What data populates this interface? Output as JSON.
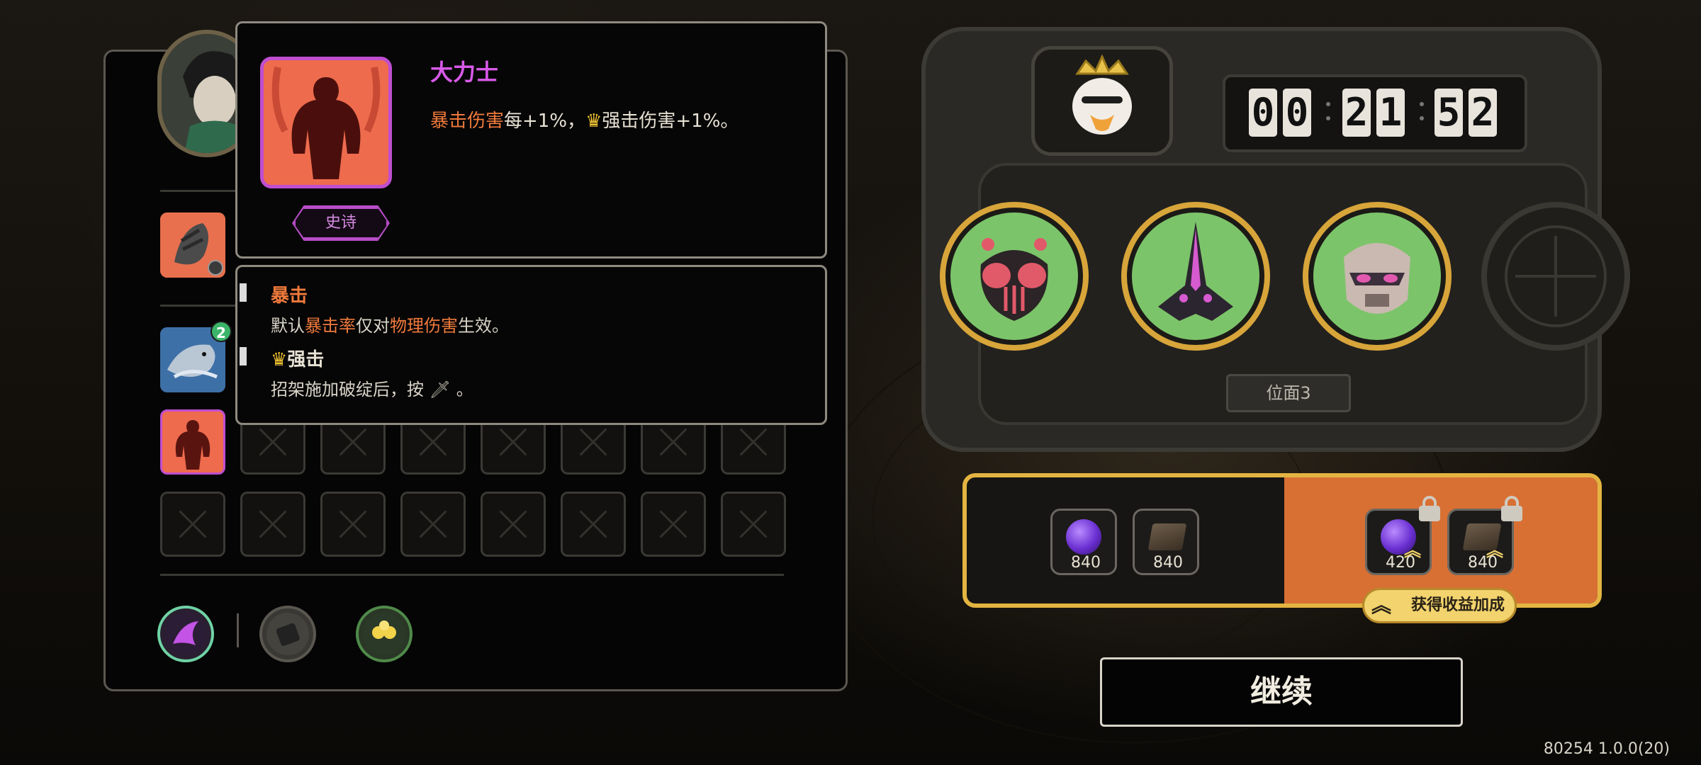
{
  "tooltip": {
    "title": "大力士",
    "desc_part1": "暴击伤害",
    "desc_part2": "每+1%，",
    "desc_part3": "强击伤害+1%。",
    "rarity": "史诗"
  },
  "keywords": {
    "crit_title": "暴击",
    "crit_desc_1": "默认",
    "crit_desc_2": "暴击率",
    "crit_desc_3": "仅对",
    "crit_desc_4": "物理伤害",
    "crit_desc_5": "生效。",
    "strong_title": "强击",
    "strong_desc": "招架施加破绽后，按",
    "strong_desc_end": "。"
  },
  "inventory": {
    "item_stack_count": "2"
  },
  "timer": {
    "digits": [
      "0",
      "0",
      "2",
      "1",
      "5",
      "2"
    ]
  },
  "plane": {
    "label": "位面3"
  },
  "rewards": {
    "free": [
      {
        "type": "orb",
        "value": "840"
      },
      {
        "type": "book",
        "value": "840"
      }
    ],
    "locked": [
      {
        "type": "orb",
        "value": "420"
      },
      {
        "type": "book",
        "value": "840"
      }
    ],
    "bonus_label": "获得收益加成"
  },
  "buttons": {
    "continue": "继续"
  },
  "version": "80254 1.0.0(20)",
  "colors": {
    "epic": "#c04ed0",
    "keyword_orange": "#f07a3c",
    "gold": "#e3b441",
    "reward_orange": "#d87034"
  }
}
